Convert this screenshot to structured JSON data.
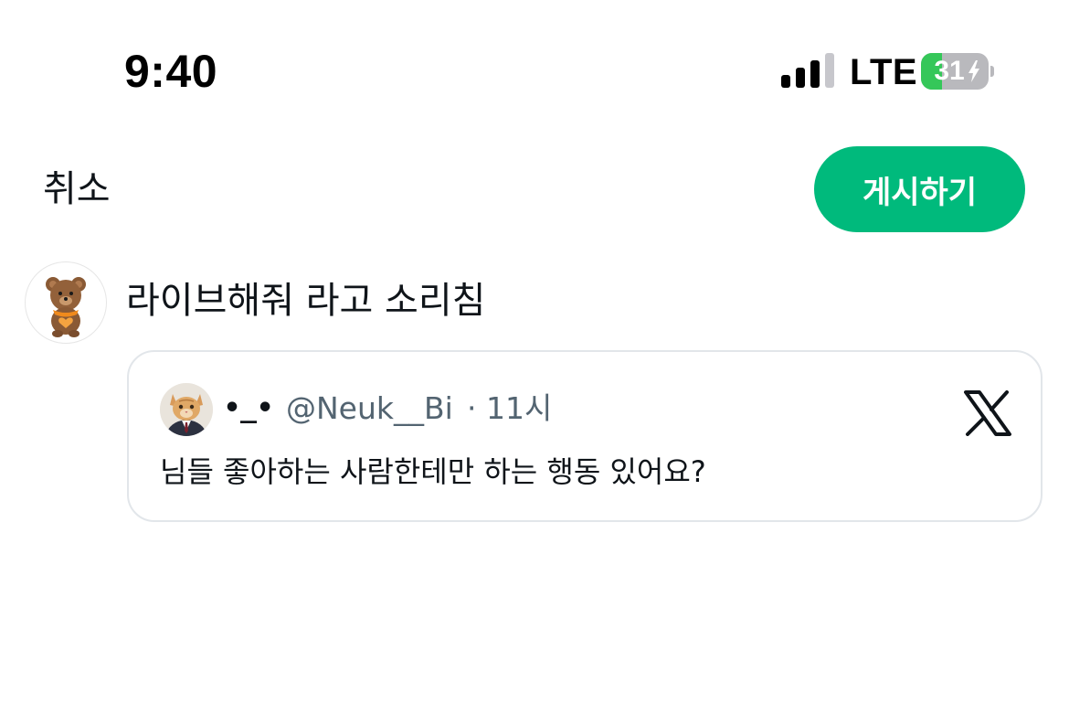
{
  "status_bar": {
    "time": "9:40",
    "network": "LTE",
    "battery_level": "31",
    "battery_fraction": 0.31,
    "signal_icon": "cellular-signal-icon",
    "charging_icon": "bolt-icon"
  },
  "header": {
    "cancel_label": "취소",
    "post_label": "게시하기"
  },
  "composer": {
    "avatar_icon": "teddy-bear-avatar",
    "text": "라이브해줘 라고 소리침"
  },
  "quote": {
    "avatar_icon": "cat-in-suit-avatar",
    "display_name": "•_•",
    "handle": "@Neuk__Bi",
    "separator": "·",
    "time": "11시",
    "body": "님들 좋아하는 사람한테만 하는 행동 있어요?",
    "source_icon": "x-logo-icon"
  },
  "colors": {
    "accent": "#00ba7c",
    "text_primary": "#0f1419",
    "text_secondary": "#536471",
    "card_border": "#e2e6ea",
    "battery_green": "#35c759"
  }
}
